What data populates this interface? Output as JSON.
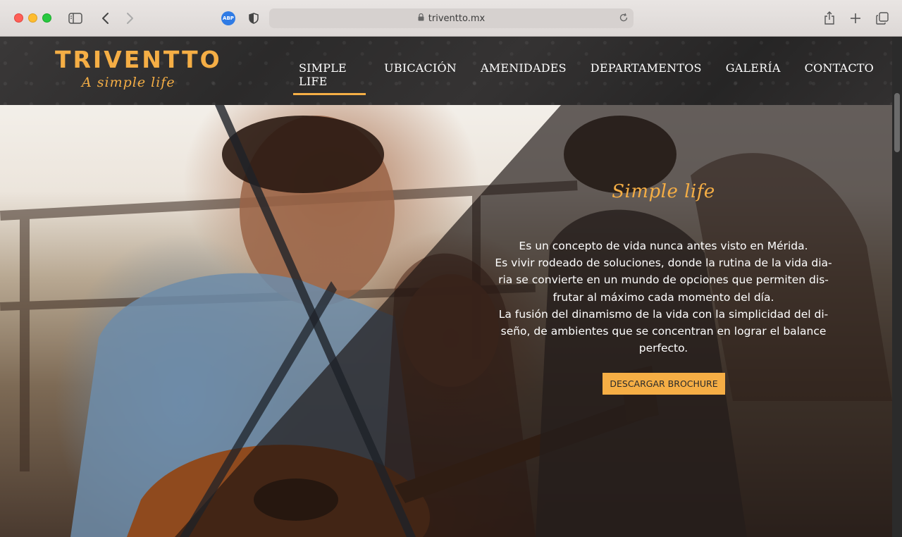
{
  "browser": {
    "url": "triventto.mx",
    "abp_label": "ABP"
  },
  "site": {
    "logo": {
      "title": "TRIVENTTO",
      "tagline": "A simple life"
    },
    "nav": [
      {
        "label": "SIMPLE LIFE",
        "active": true
      },
      {
        "label": "UBICACIÓN",
        "active": false
      },
      {
        "label": "AMENIDADES",
        "active": false
      },
      {
        "label": "DEPARTAMENTOS",
        "active": false
      },
      {
        "label": "GALERÍA",
        "active": false
      },
      {
        "label": "CONTACTO",
        "active": false
      }
    ],
    "hero": {
      "script_title": "Simple life",
      "lines": [
        "Es un concepto de vida nunca antes visto en Mérida.",
        "Es vivir rodeado de soluciones, donde la rutina de la vida dia-",
        "ria se convierte en un mundo de opciones que permiten dis-",
        "frutar al máximo cada momento del día.",
        "La fusión del dinamismo de la vida con la simplicidad del di-",
        "seño, de ambientes que se concentran en lograr el balance",
        "perfecto."
      ],
      "button_label": "DESCARGAR BROCHURE"
    }
  },
  "colors": {
    "accent": "#f5ae45",
    "header_bg": "#2f2e2e"
  },
  "icons": {
    "sidebar": "sidebar-toggle-icon",
    "back": "chevron-left-icon",
    "forward": "chevron-right-icon",
    "shield": "privacy-shield-icon",
    "lock": "lock-icon",
    "reload": "reload-icon",
    "share": "share-icon",
    "new_tab": "plus-icon",
    "tabs": "tab-overview-icon"
  }
}
